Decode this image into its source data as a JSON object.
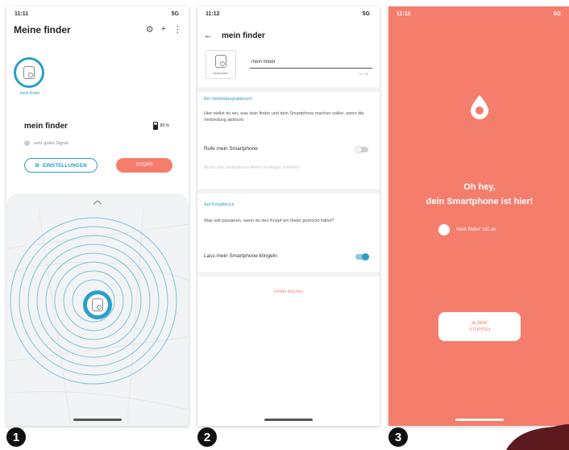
{
  "colors": {
    "accent": "#2a9fc8",
    "alarm": "#f47d6c",
    "map": "#f1f3f4"
  },
  "phone1": {
    "status_time": "11:11",
    "status_right": "5G",
    "title": "Meine finder",
    "action_icons": [
      "gear-icon",
      "plus-icon",
      "more-vert-icon"
    ],
    "finder_label": "mein finder",
    "name": "mein finder",
    "battery": "89 %",
    "signal": "sehr gutes Signal",
    "settings_button": "EINSTELLUNGEN",
    "stop_button": "STOPP"
  },
  "phone2": {
    "status_time": "11:12",
    "status_right": "5G",
    "title": "mein finder",
    "thumb_label": "bearbeiten",
    "name_value": "mein finder",
    "counter": "11 / 30",
    "section_disconnect": "Bei Verbindungsabbruch",
    "disconnect_desc": "Hier stellst du ein, was dein finder und dein Smartphone machen sollen, wenn die Verbindung abbricht.",
    "ring_phone_label": "Rufe mein Smartphone",
    "ring_phone_on": false,
    "disabled_text": "Bevor das Smartphone-Alarm festlegen erstellen",
    "section_button": "Auf Knopfdruck",
    "button_desc": "Was soll passieren, wenn du den Knopf am finder gedrückt hältst?",
    "ring_label": "Lass mein Smartphone klingeln",
    "ring_on": true,
    "find_link": "Finder löschen"
  },
  "phone3": {
    "status_time": "11:12",
    "status_right": "5G",
    "heading_line1": "Oh hey,",
    "heading_line2": "dein Smartphone ist hier!",
    "caller": "mein finder' ruft an",
    "alarm_line1": "ALARM",
    "alarm_line2": "STOPPEN"
  },
  "badges": [
    "1",
    "2",
    "3"
  ]
}
